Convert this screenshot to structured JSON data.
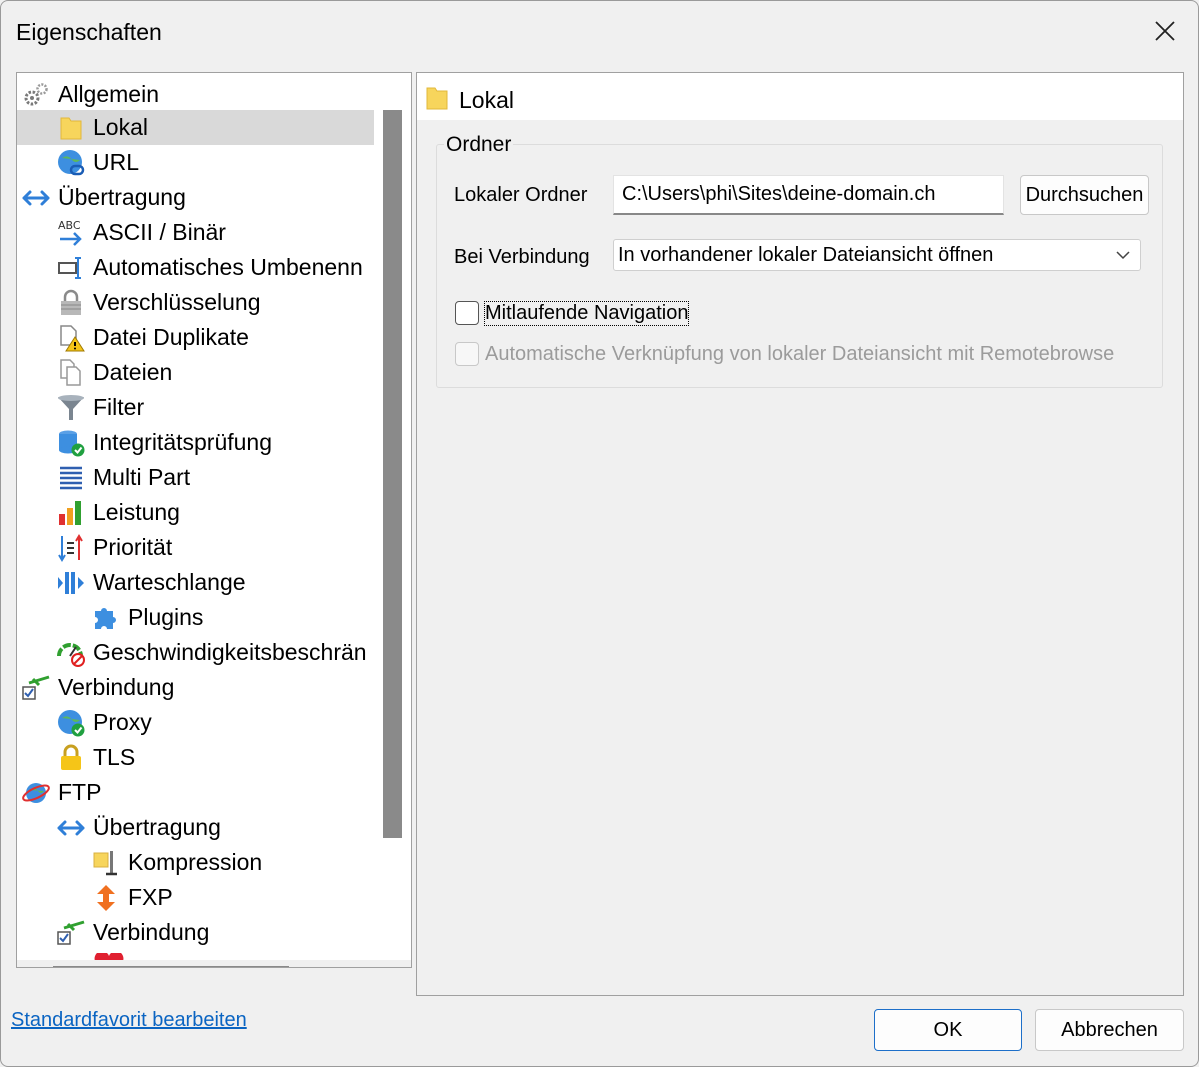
{
  "window": {
    "title": "Eigenschaften"
  },
  "tree": {
    "items": [
      {
        "label": "Allgemein",
        "icon": "gears-icon"
      },
      {
        "label": "Lokal",
        "icon": "folder-icon"
      },
      {
        "label": "URL",
        "icon": "globe-link-icon"
      },
      {
        "label": "Übertragung",
        "icon": "double-arrow-icon"
      },
      {
        "label": "ASCII / Binär",
        "icon": "ascii-arrow-icon"
      },
      {
        "label": "Automatisches Umbenenn",
        "icon": "rename-icon"
      },
      {
        "label": "Verschlüsselung",
        "icon": "padlock-icon"
      },
      {
        "label": "Datei Duplikate",
        "icon": "file-warning-icon"
      },
      {
        "label": "Dateien",
        "icon": "files-icon"
      },
      {
        "label": "Filter",
        "icon": "funnel-icon"
      },
      {
        "label": "Integritätsprüfung",
        "icon": "database-check-icon"
      },
      {
        "label": "Multi Part",
        "icon": "multipart-icon"
      },
      {
        "label": "Leistung",
        "icon": "bar-chart-icon"
      },
      {
        "label": "Priorität",
        "icon": "priority-icon"
      },
      {
        "label": "Warteschlange",
        "icon": "queue-icon"
      },
      {
        "label": "Plugins",
        "icon": "puzzle-icon"
      },
      {
        "label": "Geschwindigkeitsbeschrän",
        "icon": "speed-limit-icon"
      },
      {
        "label": "Verbindung",
        "icon": "connection-icon"
      },
      {
        "label": "Proxy",
        "icon": "globe-check-icon"
      },
      {
        "label": "TLS",
        "icon": "lock-icon"
      },
      {
        "label": "FTP",
        "icon": "ftp-globe-icon"
      },
      {
        "label": "Übertragung",
        "icon": "double-arrow-icon"
      },
      {
        "label": "Kompression",
        "icon": "compression-icon"
      },
      {
        "label": "FXP",
        "icon": "fxp-arrows-icon"
      },
      {
        "label": "Verbindung",
        "icon": "connection-icon"
      }
    ]
  },
  "panel": {
    "header_title": "Lokal",
    "group_title": "Ordner",
    "local_folder_label": "Lokaler Ordner",
    "local_folder_value": "C:\\Users\\phi\\Sites\\deine-domain.ch",
    "browse_label": "Durchsuchen",
    "on_connect_label": "Bei Verbindung",
    "on_connect_value": "In vorhandener lokaler Dateiansicht öffnen",
    "sync_nav_label": "Mitlaufende Navigation",
    "sync_nav_checked": false,
    "auto_link_label": "Automatische Verknüpfung von lokaler Dateiansicht mit Remotebrowse",
    "auto_link_checked": false
  },
  "footer": {
    "link_label": "Standardfavorit bearbeiten",
    "ok_label": "OK",
    "cancel_label": "Abbrechen"
  },
  "colors": {
    "accent": "#1d6fc9",
    "link": "#0a64c2",
    "selection": "#d9d9d9",
    "folder": "#f7d55c"
  }
}
